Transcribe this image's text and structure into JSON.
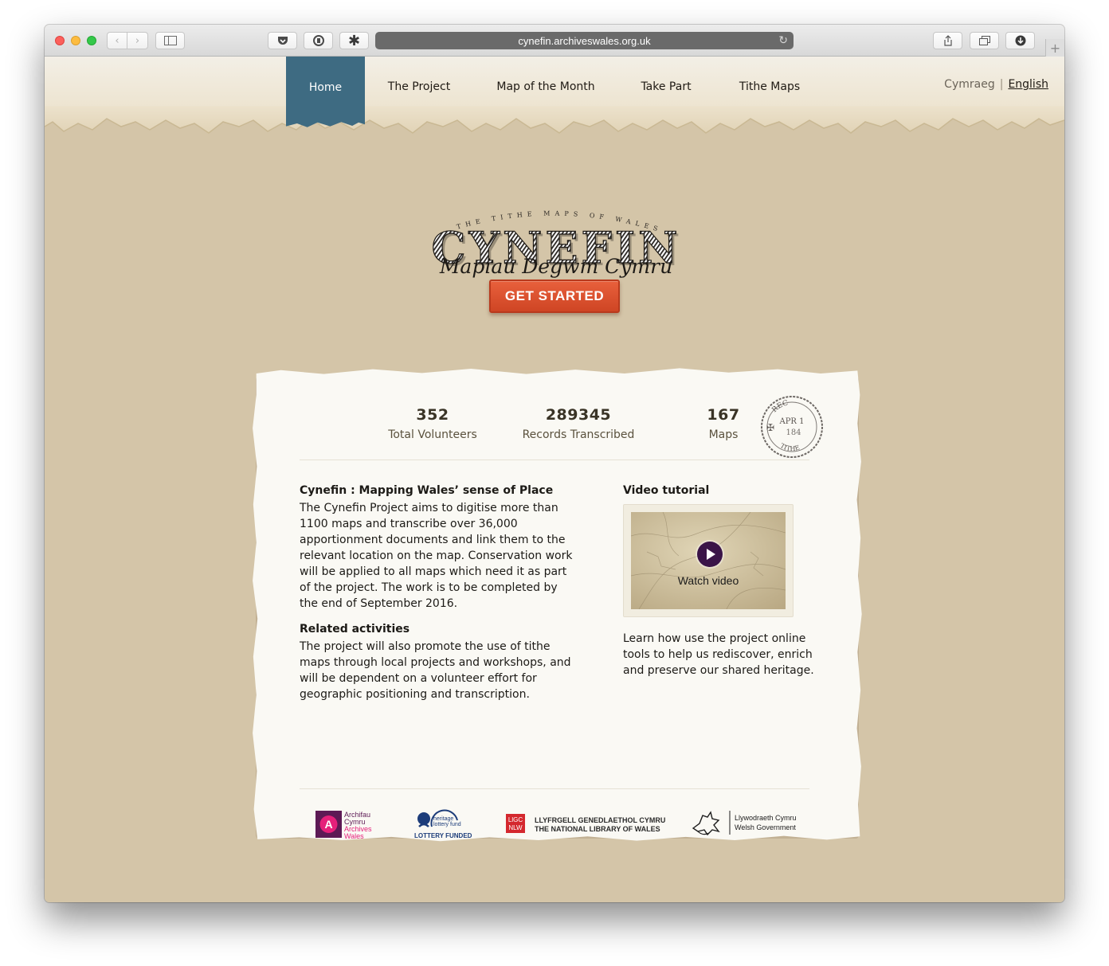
{
  "browser": {
    "url": "cynefin.archiveswales.org.uk",
    "icons": [
      "back-icon",
      "forward-icon",
      "sidebar-icon",
      "pocket-icon",
      "shield-icon",
      "asterisk-icon",
      "reload-icon",
      "share-icon",
      "tabs-icon",
      "download-icon",
      "new-tab-icon"
    ]
  },
  "nav": {
    "items": [
      {
        "label": "Home",
        "active": true
      },
      {
        "label": "The Project",
        "active": false
      },
      {
        "label": "Map of the Month",
        "active": false
      },
      {
        "label": "Take Part",
        "active": false
      },
      {
        "label": "Tithe Maps",
        "active": false
      }
    ],
    "lang_cy": "Cymraeg",
    "lang_sep": "|",
    "lang_en": "English",
    "active_color": "#3e6b82"
  },
  "hero": {
    "logo_arc_text": "THE TITHE MAPS OF WALES",
    "logo_main": "CYNEFIN",
    "logo_script": "Mapiau Degwm Cymru",
    "cta_label": "GET STARTED",
    "cta_color": "#d94f2c"
  },
  "stats": [
    {
      "value": "352",
      "label": "Total Volunteers"
    },
    {
      "value": "289345",
      "label": "Records Transcribed"
    },
    {
      "value": "167",
      "label": "Maps"
    }
  ],
  "stamp": {
    "line1": "APR 1",
    "line2": "184",
    "bottom": "TITHE",
    "top": "REC"
  },
  "about": {
    "heading": "Cynefin : Mapping Wales’ sense of Place",
    "body": "The Cynefin Project aims to digitise more than 1100 maps and transcribe over 36,000 apportionment documents and link them to the relevant location on the map. Conservation work will be applied to all maps which need it as part of the project. The work is to be completed by the end of September 2016.",
    "related_heading": "Related activities",
    "related_body": "The project will also promote the use of tithe maps through local projects and workshops, and will be dependent on a volunteer effort for geographic positioning and transcription."
  },
  "video": {
    "heading": "Video tutorial",
    "watch_label": "Watch video",
    "description": "Learn how use the project online tools to help us rediscover, enrich and preserve our shared heritage."
  },
  "partners": {
    "archives_lines": [
      "Archifau",
      "Cymru",
      "Archives",
      "Wales"
    ],
    "hlf_lines": [
      "heritage",
      "lottery fund"
    ],
    "hlf_caption": "LOTTERY FUNDED",
    "nlw_badge": [
      "LlGC",
      "NLW"
    ],
    "nlw_lines": [
      "LLYFRGELL GENEDLAETHOL CYMRU",
      "THE NATIONAL LIBRARY OF WALES"
    ],
    "wg_lines": [
      "Llywodraeth Cymru",
      "Welsh Government"
    ]
  }
}
